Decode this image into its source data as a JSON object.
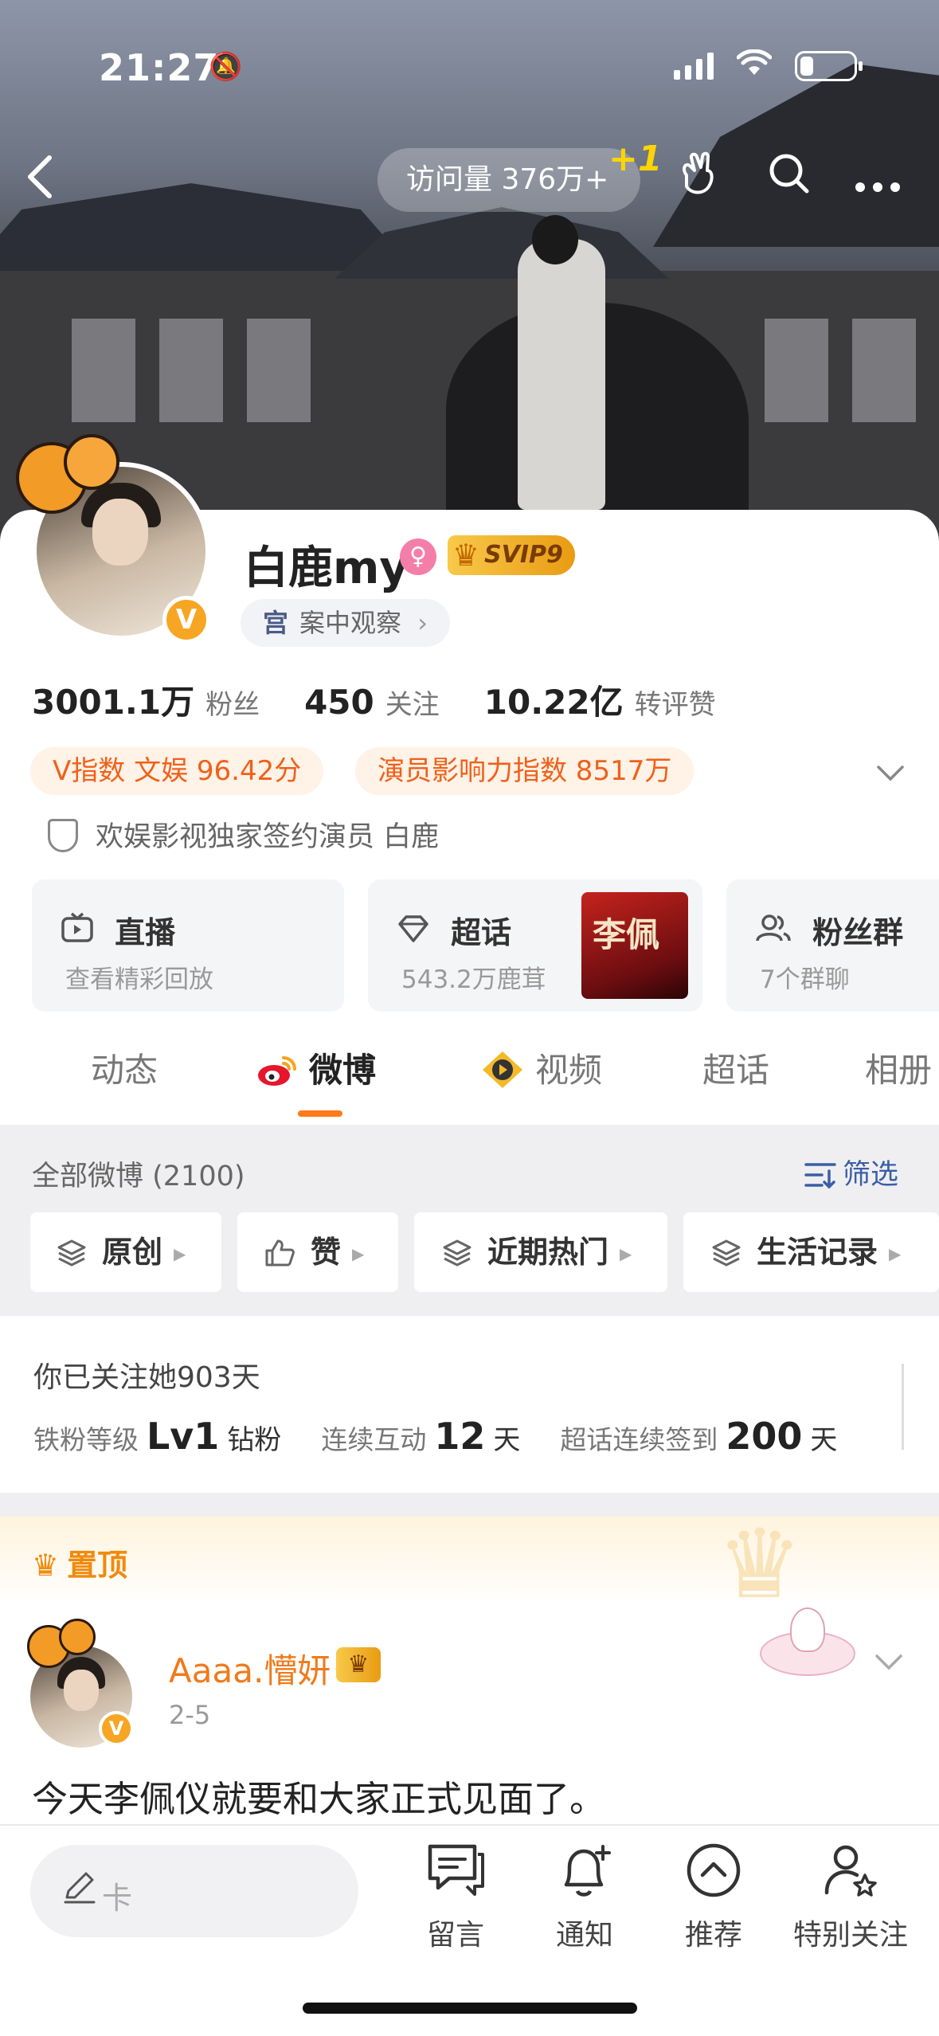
{
  "status_bar": {
    "time": "21:27",
    "silent_icon": "bell-slash-icon",
    "wifi_icon": "wifi-icon",
    "battery_level": 0.2
  },
  "nav": {
    "back_icon": "chevron-left-icon",
    "visits_label": "访问量 376万+",
    "visits_increment": "+1",
    "icons": [
      "knock-hand-icon",
      "search-icon",
      "more-icon"
    ]
  },
  "profile": {
    "name": "白鹿my",
    "gender_icon": "female-icon",
    "svip_label": "SVIP9",
    "tag_icon": "宫",
    "tag_label": "案中观察",
    "tag_chevron": "›",
    "verified_mark": "V",
    "stats": [
      {
        "value": "3001.1万",
        "label": "粉丝"
      },
      {
        "value": "450",
        "label": "关注"
      },
      {
        "value": "10.22亿",
        "label": "转评赞"
      }
    ],
    "pills": [
      "V指数 文娱 96.42分",
      "演员影响力指数 8517万"
    ],
    "verification": "欢娱影视独家签约演员 白鹿"
  },
  "features": [
    {
      "icon": "tv-icon",
      "title": "直播",
      "subtitle": "查看精彩回放"
    },
    {
      "icon": "diamond-icon",
      "title": "超话",
      "subtitle": "543.2万鹿茸"
    },
    {
      "icon": "group-icon",
      "title": "粉丝群",
      "subtitle": "7个群聊"
    }
  ],
  "tabs": [
    {
      "label": "动态"
    },
    {
      "label": "微博",
      "active": true
    },
    {
      "label": "视频"
    },
    {
      "label": "超话"
    },
    {
      "label": "相册"
    }
  ],
  "feed_header": {
    "all_label": "全部微博 (2100)",
    "filter_label": "筛选"
  },
  "filter_chips": [
    {
      "icon": "layers-icon",
      "label": "原创"
    },
    {
      "icon": "thumbs-up-icon",
      "label": "赞"
    },
    {
      "icon": "layers-icon",
      "label": "近期热门"
    },
    {
      "icon": "layers-icon",
      "label": "生活记录"
    }
  ],
  "fan_info": {
    "follow_days": "你已关注她903天",
    "level_label": "铁粉等级",
    "level_value": "Lv1",
    "level_unit": "钻粉",
    "interact_label": "连续互动",
    "interact_value": "12",
    "interact_unit": "天",
    "checkin_label": "超话连续签到",
    "checkin_value": "200",
    "checkin_unit": "天"
  },
  "pinned": {
    "label": "置顶",
    "author": "Aaaa.懵妍",
    "date": "2-5",
    "text": "今天李佩仪就要和大家正式见面了。"
  },
  "bottom_bar": {
    "input_placeholder": "卡",
    "buttons": [
      {
        "icon": "message-icon",
        "label": "留言"
      },
      {
        "icon": "bell-plus-icon",
        "label": "通知"
      },
      {
        "icon": "chevron-up-circle-icon",
        "label": "推荐"
      },
      {
        "icon": "user-star-icon",
        "label": "特别关注"
      }
    ]
  },
  "colors": {
    "accent_orange": "#ff7a1a",
    "link_blue": "#3a5fa4",
    "pill_text": "#f0601a",
    "pill_bg": "#fff2e6"
  }
}
